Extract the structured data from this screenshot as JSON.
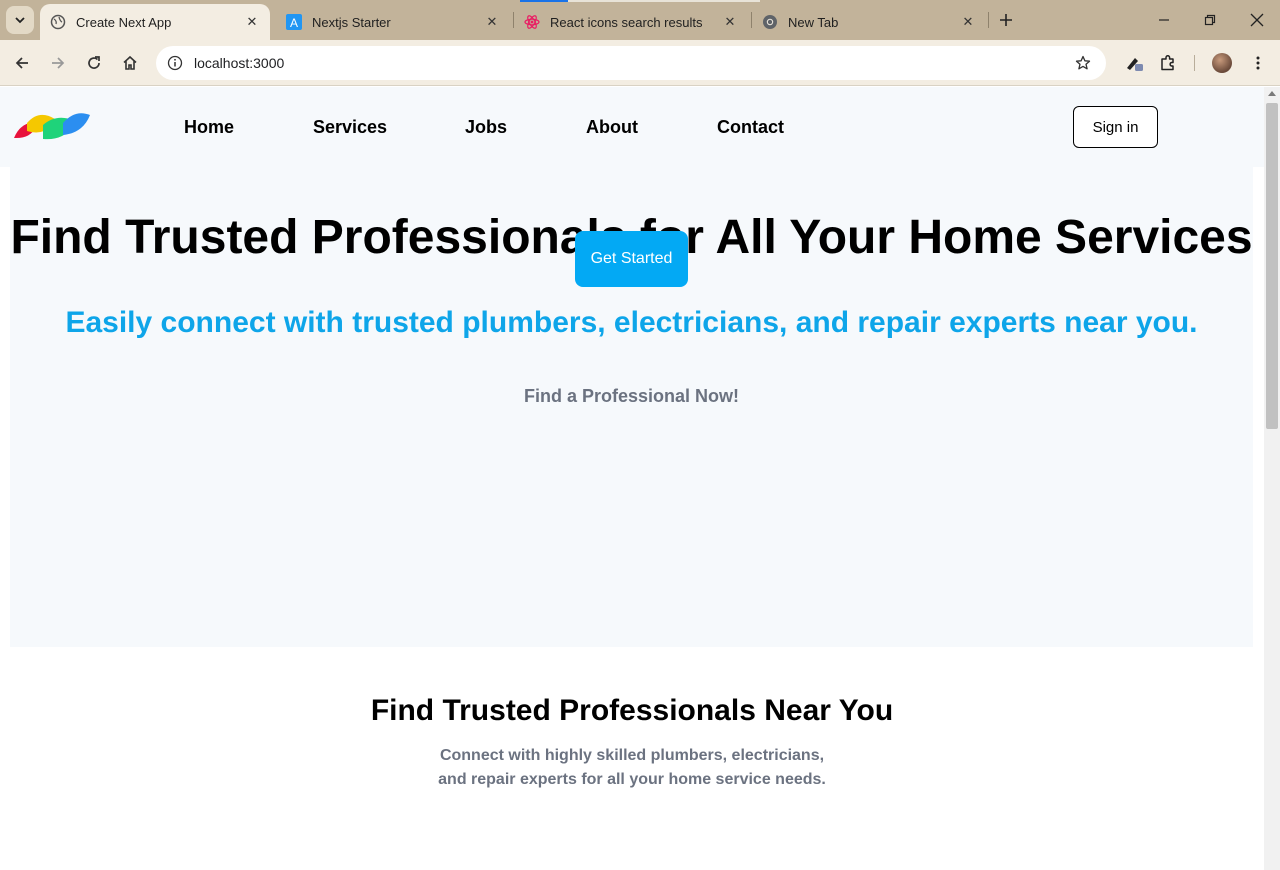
{
  "browser": {
    "tabs": [
      {
        "title": "Create Next App",
        "icon": "globe-icon",
        "active": true
      },
      {
        "title": "Nextjs Starter",
        "icon": "letter-a-icon",
        "active": false
      },
      {
        "title": "React icons search results",
        "icon": "react-icon",
        "active": false
      },
      {
        "title": "New Tab",
        "icon": "chrome-icon",
        "active": false
      }
    ],
    "url": "localhost:3000"
  },
  "navbar": {
    "links": [
      "Home",
      "Services",
      "Jobs",
      "About",
      "Contact"
    ],
    "signin_label": "Sign in"
  },
  "hero": {
    "title": "Find Trusted Professionals for All Your Home Services",
    "subtitle": "Easily connect with trusted plumbers, electricians, and repair experts near you.",
    "cta_text": "Find a Professional Now!",
    "button_label": "Get Started"
  },
  "section": {
    "title": "Find Trusted Professionals Near You",
    "desc_line1": "Connect with highly skilled plumbers, electricians,",
    "desc_line2": "and repair experts for all your home service needs."
  },
  "colors": {
    "accent": "#0ea5e9",
    "button": "#03a9f4",
    "hero_bg": "#f6f9fc",
    "muted_text": "#6b7280",
    "tabstrip": "#c2b39a"
  }
}
